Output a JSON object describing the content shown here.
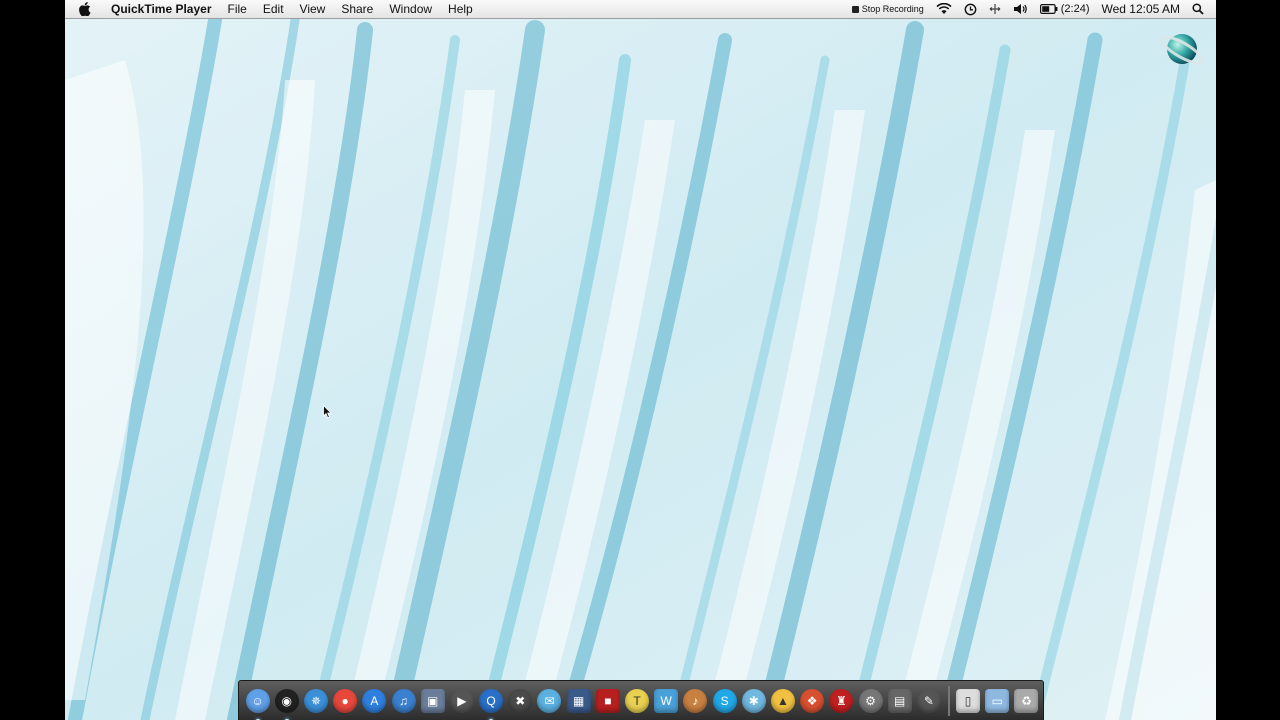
{
  "menubar": {
    "app_name": "QuickTime Player",
    "menus": [
      "File",
      "Edit",
      "View",
      "Share",
      "Window",
      "Help"
    ],
    "status": {
      "recording_label": "Stop Recording",
      "battery_label": "(2:24)",
      "clock": "Wed 12:05 AM"
    }
  },
  "dock": {
    "items": [
      {
        "icon": "finder-icon",
        "color": "#5fa0e8"
      },
      {
        "icon": "dashboard-icon",
        "color": "#222222"
      },
      {
        "icon": "safari-icon",
        "color": "#3b8fd8"
      },
      {
        "icon": "chrome-icon",
        "color": "#e8483c"
      },
      {
        "icon": "app-store-icon",
        "color": "#2f7fe0"
      },
      {
        "icon": "itunes-icon",
        "color": "#3a80d0"
      },
      {
        "icon": "preview-icon",
        "color": "#6a7e9a"
      },
      {
        "icon": "facetime-icon",
        "color": "#555555"
      },
      {
        "icon": "quicktime-icon",
        "color": "#2a6fc8"
      },
      {
        "icon": "tool-icon",
        "color": "#4a4a4a"
      },
      {
        "icon": "mail-icon",
        "color": "#5ab0e0"
      },
      {
        "icon": "spaces-icon",
        "color": "#3a5a8a"
      },
      {
        "icon": "photo-booth-icon",
        "color": "#b82020"
      },
      {
        "icon": "tshirt-icon",
        "color": "#e8d050"
      },
      {
        "icon": "text-editor-icon",
        "color": "#4aa0d8"
      },
      {
        "icon": "guitar-icon",
        "color": "#c88040"
      },
      {
        "icon": "skype-icon",
        "color": "#20a8e8"
      },
      {
        "icon": "bug-icon",
        "color": "#70b8e0"
      },
      {
        "icon": "vlc-icon",
        "color": "#f0c040"
      },
      {
        "icon": "photo-icon",
        "color": "#d85030"
      },
      {
        "icon": "game-icon",
        "color": "#c02020"
      },
      {
        "icon": "system-preferences-icon",
        "color": "#777777"
      },
      {
        "icon": "video-icon",
        "color": "#666666"
      },
      {
        "icon": "pen-icon",
        "color": "#555555"
      },
      {
        "icon": "document-icon",
        "color": "#dddddd"
      },
      {
        "icon": "folder-icon",
        "color": "#8fb8e0"
      },
      {
        "icon": "trash-icon",
        "color": "#aaaaaa"
      }
    ]
  }
}
